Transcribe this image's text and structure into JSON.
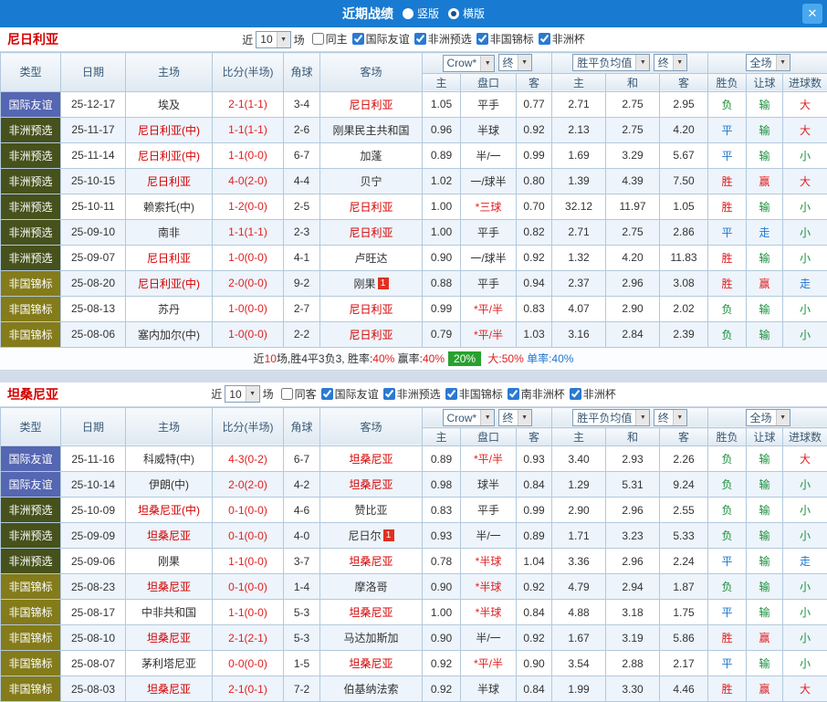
{
  "titlebar": {
    "title": "近期战绩",
    "close_icon": "✕",
    "radio_options": [
      {
        "label": "竖版",
        "selected": false
      },
      {
        "label": "横版",
        "selected": true
      }
    ]
  },
  "table_header": {
    "type": "类型",
    "date": "日期",
    "home": "主场",
    "score": "比分(半场)",
    "corner": "角球",
    "away": "客场",
    "company": "Crow*",
    "final": "终",
    "avg": "胜平负均值",
    "scope": "全场",
    "sub": [
      "主",
      "盘口",
      "客",
      "主",
      "和",
      "客",
      "胜负",
      "让球",
      "进球数"
    ]
  },
  "sections": [
    {
      "team": "尼日利亚",
      "near_label": "近",
      "near_value": "10",
      "games_label": "场",
      "filters": [
        {
          "label": "同主",
          "checked": false
        },
        {
          "label": "国际友谊",
          "checked": true
        },
        {
          "label": "非洲预选",
          "checked": true
        },
        {
          "label": "非国锦标",
          "checked": true
        },
        {
          "label": "非洲杯",
          "checked": true
        }
      ],
      "rows": [
        {
          "type": "国际友谊",
          "tc": "blue",
          "date": "25-12-17",
          "home": "埃及",
          "hr": false,
          "hb": "",
          "score": "2-1(1-1)",
          "corner": "3-4",
          "away": "尼日利亚",
          "ar": true,
          "ab": "",
          "o1": "1.05",
          "hc": "平手",
          "hcr": false,
          "o2": "0.77",
          "a1": "2.71",
          "a2": "2.75",
          "a3": "2.95",
          "r1": [
            "负",
            "green"
          ],
          "r2": [
            "输",
            "green"
          ],
          "r3": [
            "大",
            "red"
          ]
        },
        {
          "type": "非洲预选",
          "tc": "olive",
          "date": "25-11-17",
          "home": "尼日利亚(中)",
          "hr": true,
          "hb": "",
          "score": "1-1(1-1)",
          "corner": "2-6",
          "away": "刚果民主共和国",
          "ar": false,
          "ab": "",
          "o1": "0.96",
          "hc": "半球",
          "hcr": false,
          "o2": "0.92",
          "a1": "2.13",
          "a2": "2.75",
          "a3": "4.20",
          "r1": [
            "平",
            "blue"
          ],
          "r2": [
            "输",
            "green"
          ],
          "r3": [
            "大",
            "red"
          ]
        },
        {
          "type": "非洲预选",
          "tc": "olive",
          "date": "25-11-14",
          "home": "尼日利亚(中)",
          "hr": true,
          "hb": "",
          "score": "1-1(0-0)",
          "corner": "6-7",
          "away": "加蓬",
          "ar": false,
          "ab": "",
          "o1": "0.89",
          "hc": "半/一",
          "hcr": false,
          "o2": "0.99",
          "a1": "1.69",
          "a2": "3.29",
          "a3": "5.67",
          "r1": [
            "平",
            "blue"
          ],
          "r2": [
            "输",
            "green"
          ],
          "r3": [
            "小",
            "green"
          ]
        },
        {
          "type": "非洲预选",
          "tc": "olive",
          "date": "25-10-15",
          "home": "尼日利亚",
          "hr": true,
          "hb": "",
          "score": "4-0(2-0)",
          "corner": "4-4",
          "away": "贝宁",
          "ar": false,
          "ab": "",
          "o1": "1.02",
          "hc": "一/球半",
          "hcr": false,
          "o2": "0.80",
          "a1": "1.39",
          "a2": "4.39",
          "a3": "7.50",
          "r1": [
            "胜",
            "red"
          ],
          "r2": [
            "赢",
            "red"
          ],
          "r3": [
            "大",
            "red"
          ]
        },
        {
          "type": "非洲预选",
          "tc": "olive",
          "date": "25-10-11",
          "home": "赖索托(中)",
          "hr": false,
          "hb": "",
          "score": "1-2(0-0)",
          "corner": "2-5",
          "away": "尼日利亚",
          "ar": true,
          "ab": "",
          "o1": "1.00",
          "hc": "*三球",
          "hcr": true,
          "o2": "0.70",
          "a1": "32.12",
          "a2": "11.97",
          "a3": "1.05",
          "r1": [
            "胜",
            "red"
          ],
          "r2": [
            "输",
            "green"
          ],
          "r3": [
            "小",
            "green"
          ]
        },
        {
          "type": "非洲预选",
          "tc": "olive",
          "date": "25-09-10",
          "home": "南非",
          "hr": false,
          "hb": "",
          "score": "1-1(1-1)",
          "corner": "2-3",
          "away": "尼日利亚",
          "ar": true,
          "ab": "",
          "o1": "1.00",
          "hc": "平手",
          "hcr": false,
          "o2": "0.82",
          "a1": "2.71",
          "a2": "2.75",
          "a3": "2.86",
          "r1": [
            "平",
            "blue"
          ],
          "r2": [
            "走",
            "blue"
          ],
          "r3": [
            "小",
            "green"
          ]
        },
        {
          "type": "非洲预选",
          "tc": "olive",
          "date": "25-09-07",
          "home": "尼日利亚",
          "hr": true,
          "hb": "",
          "score": "1-0(0-0)",
          "corner": "4-1",
          "away": "卢旺达",
          "ar": false,
          "ab": "",
          "o1": "0.90",
          "hc": "一/球半",
          "hcr": false,
          "o2": "0.92",
          "a1": "1.32",
          "a2": "4.20",
          "a3": "11.83",
          "r1": [
            "胜",
            "red"
          ],
          "r2": [
            "输",
            "green"
          ],
          "r3": [
            "小",
            "green"
          ]
        },
        {
          "type": "非国锦标",
          "tc": "gold",
          "date": "25-08-20",
          "home": "尼日利亚(中)",
          "hr": true,
          "hb": "",
          "score": "2-0(0-0)",
          "corner": "9-2",
          "away": "刚果",
          "ar": false,
          "ab": "1",
          "o1": "0.88",
          "hc": "平手",
          "hcr": false,
          "o2": "0.94",
          "a1": "2.37",
          "a2": "2.96",
          "a3": "3.08",
          "r1": [
            "胜",
            "red"
          ],
          "r2": [
            "赢",
            "red"
          ],
          "r3": [
            "走",
            "blue"
          ]
        },
        {
          "type": "非国锦标",
          "tc": "gold",
          "date": "25-08-13",
          "home": "苏丹",
          "hr": false,
          "hb": "",
          "score": "1-0(0-0)",
          "corner": "2-7",
          "away": "尼日利亚",
          "ar": true,
          "ab": "",
          "o1": "0.99",
          "hc": "*平/半",
          "hcr": true,
          "o2": "0.83",
          "a1": "4.07",
          "a2": "2.90",
          "a3": "2.02",
          "r1": [
            "负",
            "green"
          ],
          "r2": [
            "输",
            "green"
          ],
          "r3": [
            "小",
            "green"
          ]
        },
        {
          "type": "非国锦标",
          "tc": "gold",
          "date": "25-08-06",
          "home": "塞内加尔(中)",
          "hr": false,
          "hb": "",
          "score": "1-0(0-0)",
          "corner": "2-2",
          "away": "尼日利亚",
          "ar": true,
          "ab": "",
          "o1": "0.79",
          "hc": "*平/半",
          "hcr": true,
          "o2": "1.03",
          "a1": "3.16",
          "a2": "2.84",
          "a3": "2.39",
          "r1": [
            "负",
            "green"
          ],
          "r2": [
            "输",
            "green"
          ],
          "r3": [
            "小",
            "green"
          ]
        }
      ],
      "summary": [
        {
          "t": "近",
          "c": "#333333"
        },
        {
          "t": "10",
          "c": "#e01f1f"
        },
        {
          "t": "场,胜4平3负3, 胜率:",
          "c": "#333333"
        },
        {
          "t": "40%",
          "c": "#e01f1f"
        },
        {
          "t": " 赢率:",
          "c": "#333333"
        },
        {
          "t": "40%",
          "c": "#e01f1f"
        },
        {
          "t": "20%",
          "badge": true
        },
        {
          "t": " 大:",
          "c": "#e01f1f"
        },
        {
          "t": "50%",
          "c": "#e01f1f"
        },
        {
          "t": " 单率:",
          "c": "#2077cc"
        },
        {
          "t": "40%",
          "c": "#2077cc"
        }
      ]
    },
    {
      "team": "坦桑尼亚",
      "near_label": "近",
      "near_value": "10",
      "games_label": "场",
      "filters": [
        {
          "label": "同客",
          "checked": false
        },
        {
          "label": "国际友谊",
          "checked": true
        },
        {
          "label": "非洲预选",
          "checked": true
        },
        {
          "label": "非国锦标",
          "checked": true
        },
        {
          "label": "南非洲杯",
          "checked": true
        },
        {
          "label": "非洲杯",
          "checked": true
        }
      ],
      "rows": [
        {
          "type": "国际友谊",
          "tc": "blue",
          "date": "25-11-16",
          "home": "科威特(中)",
          "hr": false,
          "hb": "",
          "score": "4-3(0-2)",
          "corner": "6-7",
          "away": "坦桑尼亚",
          "ar": true,
          "ab": "",
          "o1": "0.89",
          "hc": "*平/半",
          "hcr": true,
          "o2": "0.93",
          "a1": "3.40",
          "a2": "2.93",
          "a3": "2.26",
          "r1": [
            "负",
            "green"
          ],
          "r2": [
            "输",
            "green"
          ],
          "r3": [
            "大",
            "red"
          ]
        },
        {
          "type": "国际友谊",
          "tc": "blue",
          "date": "25-10-14",
          "home": "伊朗(中)",
          "hr": false,
          "hb": "",
          "score": "2-0(2-0)",
          "corner": "4-2",
          "away": "坦桑尼亚",
          "ar": true,
          "ab": "",
          "o1": "0.98",
          "hc": "球半",
          "hcr": false,
          "o2": "0.84",
          "a1": "1.29",
          "a2": "5.31",
          "a3": "9.24",
          "r1": [
            "负",
            "green"
          ],
          "r2": [
            "输",
            "green"
          ],
          "r3": [
            "小",
            "green"
          ]
        },
        {
          "type": "非洲预选",
          "tc": "olive",
          "date": "25-10-09",
          "home": "坦桑尼亚(中)",
          "hr": true,
          "hb": "",
          "score": "0-1(0-0)",
          "corner": "4-6",
          "away": "赞比亚",
          "ar": false,
          "ab": "",
          "o1": "0.83",
          "hc": "平手",
          "hcr": false,
          "o2": "0.99",
          "a1": "2.90",
          "a2": "2.96",
          "a3": "2.55",
          "r1": [
            "负",
            "green"
          ],
          "r2": [
            "输",
            "green"
          ],
          "r3": [
            "小",
            "green"
          ]
        },
        {
          "type": "非洲预选",
          "tc": "olive",
          "date": "25-09-09",
          "home": "坦桑尼亚",
          "hr": true,
          "hb": "",
          "score": "0-1(0-0)",
          "corner": "4-0",
          "away": "尼日尔",
          "ar": false,
          "ab": "1",
          "o1": "0.93",
          "hc": "半/一",
          "hcr": false,
          "o2": "0.89",
          "a1": "1.71",
          "a2": "3.23",
          "a3": "5.33",
          "r1": [
            "负",
            "green"
          ],
          "r2": [
            "输",
            "green"
          ],
          "r3": [
            "小",
            "green"
          ]
        },
        {
          "type": "非洲预选",
          "tc": "olive",
          "date": "25-09-06",
          "home": "刚果",
          "hr": false,
          "hb": "",
          "score": "1-1(0-0)",
          "corner": "3-7",
          "away": "坦桑尼亚",
          "ar": true,
          "ab": "",
          "o1": "0.78",
          "hc": "*半球",
          "hcr": true,
          "o2": "1.04",
          "a1": "3.36",
          "a2": "2.96",
          "a3": "2.24",
          "r1": [
            "平",
            "blue"
          ],
          "r2": [
            "输",
            "green"
          ],
          "r3": [
            "走",
            "blue"
          ]
        },
        {
          "type": "非国锦标",
          "tc": "gold",
          "date": "25-08-23",
          "home": "坦桑尼亚",
          "hr": true,
          "hb": "",
          "score": "0-1(0-0)",
          "corner": "1-4",
          "away": "摩洛哥",
          "ar": false,
          "ab": "",
          "o1": "0.90",
          "hc": "*半球",
          "hcr": true,
          "o2": "0.92",
          "a1": "4.79",
          "a2": "2.94",
          "a3": "1.87",
          "r1": [
            "负",
            "green"
          ],
          "r2": [
            "输",
            "green"
          ],
          "r3": [
            "小",
            "green"
          ]
        },
        {
          "type": "非国锦标",
          "tc": "gold",
          "date": "25-08-17",
          "home": "中非共和国",
          "hr": false,
          "hb": "",
          "score": "1-1(0-0)",
          "corner": "5-3",
          "away": "坦桑尼亚",
          "ar": true,
          "ab": "",
          "o1": "1.00",
          "hc": "*半球",
          "hcr": true,
          "o2": "0.84",
          "a1": "4.88",
          "a2": "3.18",
          "a3": "1.75",
          "r1": [
            "平",
            "blue"
          ],
          "r2": [
            "输",
            "green"
          ],
          "r3": [
            "小",
            "green"
          ]
        },
        {
          "type": "非国锦标",
          "tc": "gold",
          "date": "25-08-10",
          "home": "坦桑尼亚",
          "hr": true,
          "hb": "",
          "score": "2-1(2-1)",
          "corner": "5-3",
          "away": "马达加斯加",
          "ar": false,
          "ab": "",
          "o1": "0.90",
          "hc": "半/一",
          "hcr": false,
          "o2": "0.92",
          "a1": "1.67",
          "a2": "3.19",
          "a3": "5.86",
          "r1": [
            "胜",
            "red"
          ],
          "r2": [
            "赢",
            "red"
          ],
          "r3": [
            "小",
            "green"
          ]
        },
        {
          "type": "非国锦标",
          "tc": "gold",
          "date": "25-08-07",
          "home": "茅利塔尼亚",
          "hr": false,
          "hb": "",
          "score": "0-0(0-0)",
          "corner": "1-5",
          "away": "坦桑尼亚",
          "ar": true,
          "ab": "",
          "o1": "0.92",
          "hc": "*平/半",
          "hcr": true,
          "o2": "0.90",
          "a1": "3.54",
          "a2": "2.88",
          "a3": "2.17",
          "r1": [
            "平",
            "blue"
          ],
          "r2": [
            "输",
            "green"
          ],
          "r3": [
            "小",
            "green"
          ]
        },
        {
          "type": "非国锦标",
          "tc": "gold",
          "date": "25-08-03",
          "home": "坦桑尼亚",
          "hr": true,
          "hb": "",
          "score": "2-1(0-1)",
          "corner": "7-2",
          "away": "伯基纳法索",
          "ar": false,
          "ab": "",
          "o1": "0.92",
          "hc": "半球",
          "hcr": false,
          "o2": "0.84",
          "a1": "1.99",
          "a2": "3.30",
          "a3": "4.46",
          "r1": [
            "胜",
            "red"
          ],
          "r2": [
            "赢",
            "red"
          ],
          "r3": [
            "大",
            "red"
          ]
        }
      ],
      "summary": null
    }
  ]
}
